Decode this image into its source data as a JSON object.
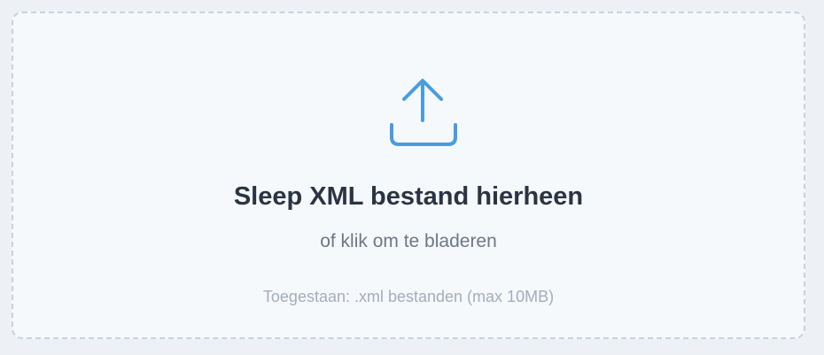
{
  "dropzone": {
    "icon": "upload-icon",
    "title": "Sleep XML bestand hierheen",
    "subtitle": "of klik om te bladeren",
    "hint": "Toegestaan: .xml bestanden (max 10MB)"
  },
  "colors": {
    "accent": "#4a9ce0",
    "border": "#c6d2df",
    "background": "#f6f9fc",
    "title": "#2b3442",
    "subtitle": "#6d7788",
    "hint": "#a4adbb"
  }
}
